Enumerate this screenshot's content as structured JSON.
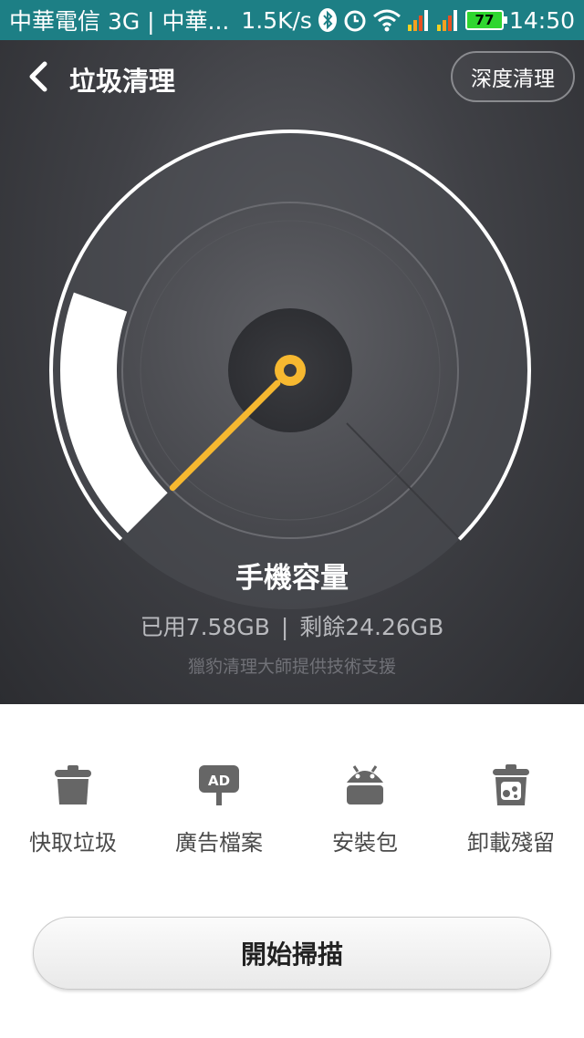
{
  "status_bar": {
    "carrier": "中華電信 3G | 中華...",
    "speed": "1.5K/s",
    "battery": "77",
    "time": "14:50",
    "icons": [
      "bluetooth-icon",
      "alarm-icon",
      "wifi-icon",
      "signal-icon",
      "signal-icon",
      "battery-icon"
    ]
  },
  "header": {
    "back_icon": "chevron-left-icon",
    "title": "垃圾清理",
    "deep_clean_label": "深度清理"
  },
  "gauge": {
    "used_fraction": 0.24,
    "colors": {
      "arc": "#ffffff",
      "needle": "#f6b830"
    }
  },
  "storage": {
    "title": "手機容量",
    "used": "已用7.58GB",
    "separator": "|",
    "remaining": "剩餘24.26GB",
    "powered_by": "獵豹清理大師提供技術支援"
  },
  "categories": [
    {
      "icon": "trash-can-icon",
      "label": "快取垃圾"
    },
    {
      "icon": "ad-sign-icon",
      "label": "廣告檔案"
    },
    {
      "icon": "android-icon",
      "label": "安裝包"
    },
    {
      "icon": "residue-bin-icon",
      "label": "卸載殘留"
    }
  ],
  "scan_button": {
    "label": "開始掃描"
  }
}
